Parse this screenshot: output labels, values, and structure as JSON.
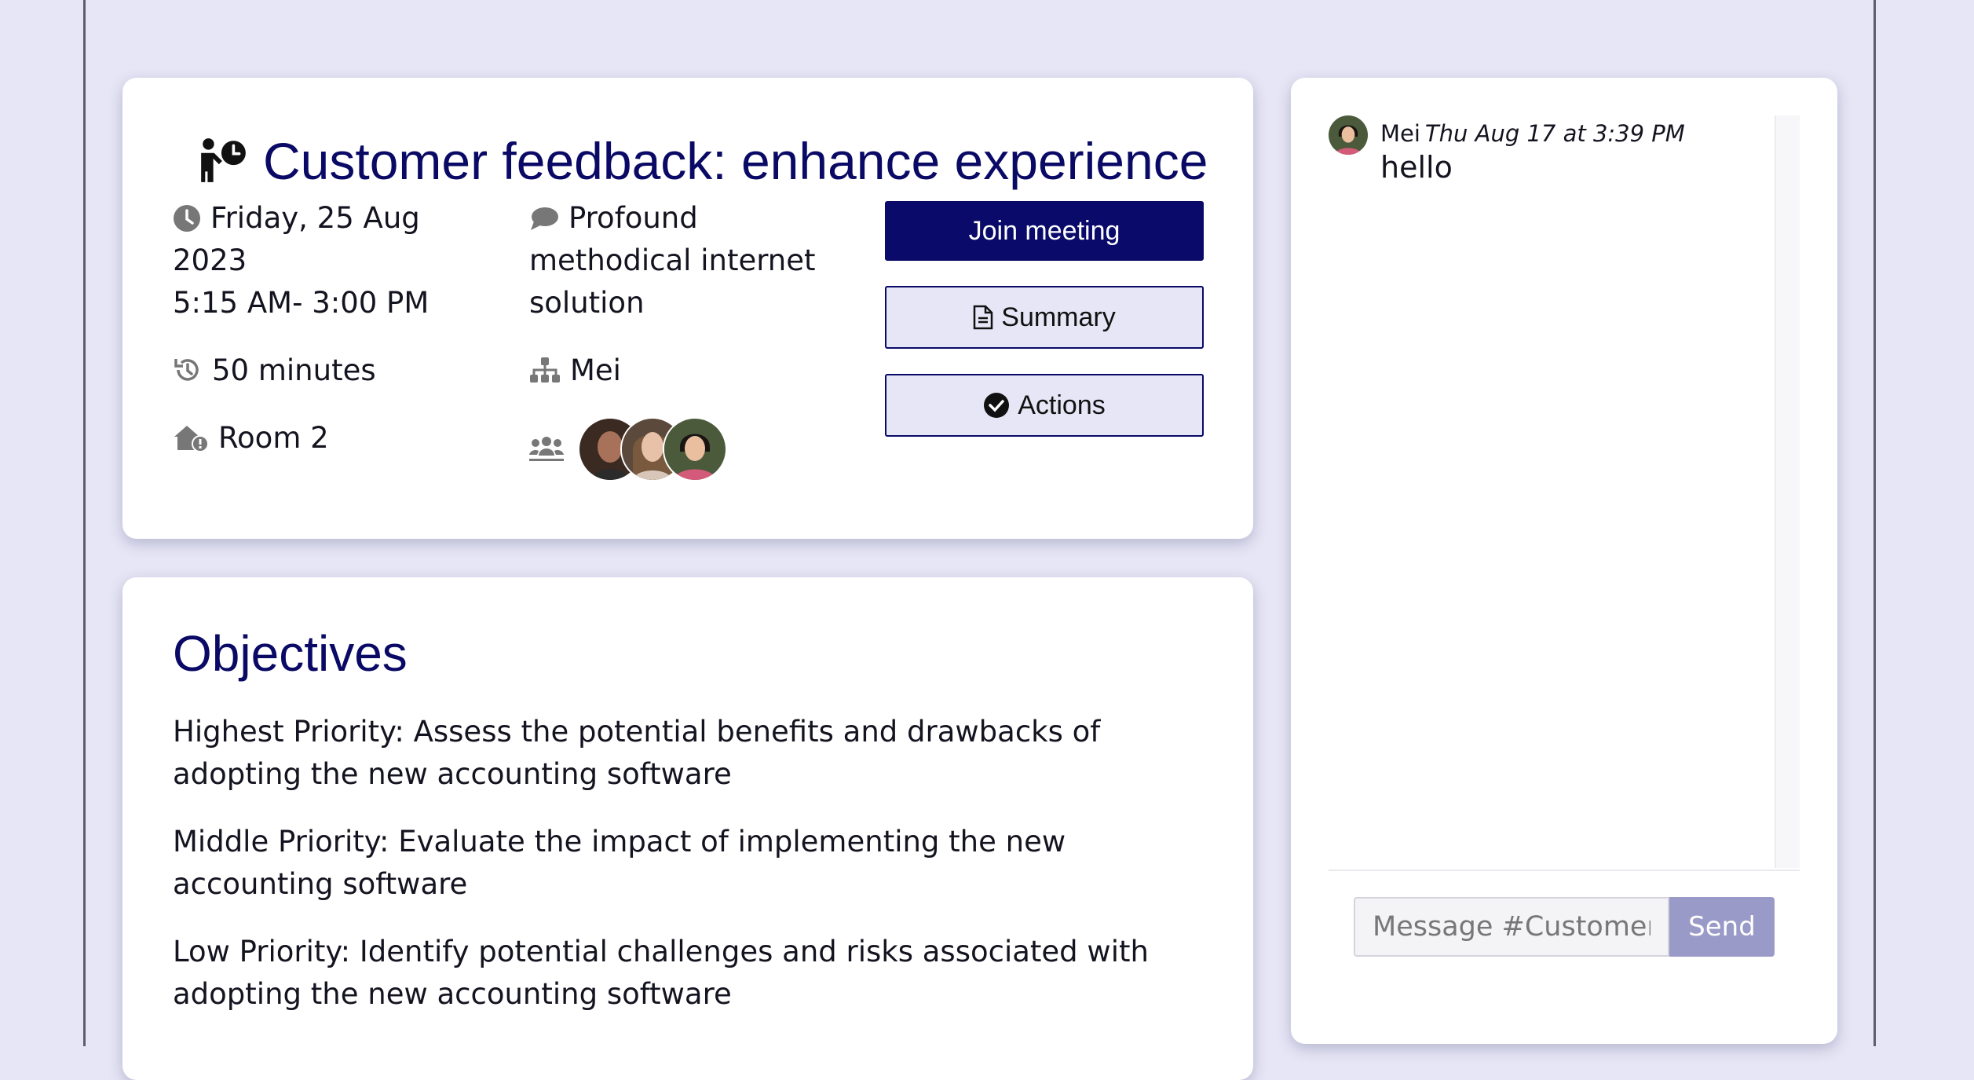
{
  "meeting": {
    "title": "Customer feedback: enhance experience",
    "date": "Friday, 25 Aug 2023",
    "time_range": "5:15 AM- 3:00 PM",
    "duration": "50 minutes",
    "room": "Room 2",
    "topic": "Profound methodical internet solution",
    "organizer": "Mei",
    "join_label": "Join meeting",
    "summary_label": "Summary",
    "actions_label": "Actions"
  },
  "objectives": {
    "heading": "Objectives",
    "items": [
      "Highest Priority: Assess the potential benefits and drawbacks of adopting the new accounting software",
      "Middle Priority: Evaluate the impact of implementing the new accounting software",
      "Low Priority: Identify potential challenges and risks associated with adopting the new accounting software"
    ]
  },
  "chat": {
    "messages": [
      {
        "author": "Mei",
        "time": "Thu Aug 17 at 3:39 PM",
        "text": "hello"
      }
    ],
    "input_placeholder": "Message #Customer feedback: enhance experience",
    "send_label": "Send"
  },
  "colors": {
    "page_bg": "#e6e6f6",
    "accent": "#0a0a66",
    "send_button": "#9a9ac8"
  }
}
